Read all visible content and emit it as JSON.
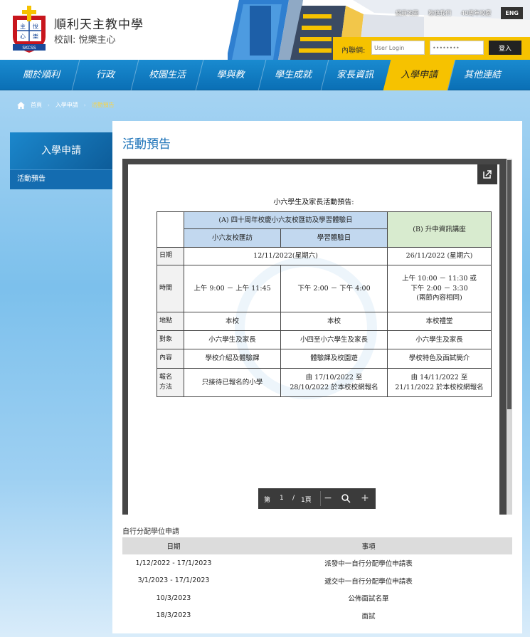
{
  "school": {
    "name": "順利天主教中學",
    "motto": "校訓: 悅樂主心",
    "logo_text": [
      "主",
      "悅",
      "心",
      "樂"
    ],
    "logo_banner": "SKCSS"
  },
  "toplinks": {
    "sitemap": "網頁地圖",
    "contact": "聯絡我們",
    "anniversary": "40周年校慶",
    "eng": "ENG"
  },
  "login": {
    "label": "內聯網:",
    "user_placeholder": "User Login",
    "password_value": "••••••••",
    "button": "登入"
  },
  "nav": [
    {
      "label": "關於順利"
    },
    {
      "label": "行政"
    },
    {
      "label": "校園生活"
    },
    {
      "label": "學與教"
    },
    {
      "label": "學生成就"
    },
    {
      "label": "家長資訊"
    },
    {
      "label": "入學申請"
    },
    {
      "label": "其他連結"
    }
  ],
  "breadcrumb": {
    "home": "首頁",
    "section": "入學申請",
    "current": "活動預告"
  },
  "sidebar": {
    "title": "入學申請",
    "item": "活動預告"
  },
  "page_title": "活動預告",
  "document": {
    "title": "小六學生及家長活動預告:",
    "group_a": "(A) 四十周年校慶小六友校匯訪及學習體驗日",
    "group_b": "(B) 升中資訊講座",
    "sub_a1": "小六友校匯訪",
    "sub_a2": "學習體驗日",
    "rows": {
      "date_label": "日期",
      "date_a": "12/11/2022(星期六)",
      "date_b": "26/11/2022 (星期六)",
      "time_label": "時間",
      "time_a1": "上午 9:00 － 上午 11:45",
      "time_a2": "下午 2:00 － 下午 4:00",
      "time_b_1": "上午 10:00 － 11:30 或",
      "time_b_2": "下午 2:00 － 3:30",
      "time_b_3": "(兩節內容相同)",
      "venue_label": "地點",
      "venue_a1": "本校",
      "venue_a2": "本校",
      "venue_b": "本校禮堂",
      "target_label": "對象",
      "target_a1": "小六學生及家長",
      "target_a2": "小四至小六學生及家長",
      "target_b": "小六學生及家長",
      "content_label": "內容",
      "content_a1": "學校介紹及體驗課",
      "content_a2": "體驗課及校園遊",
      "content_b": "學校特色及面試簡介",
      "reg_label_1": "報名",
      "reg_label_2": "方法",
      "reg_a1": "只接待已報名的小學",
      "reg_a2_1": "由 17/10/2022 至",
      "reg_a2_2": "28/10/2022 於本校校網報名",
      "reg_b_1": "由 14/11/2022 至",
      "reg_b_2": "21/11/2022 於本校校網報名"
    }
  },
  "pager": {
    "prefix": "第",
    "page": "1",
    "sep": "/",
    "total": "1頁",
    "minus": "−",
    "plus": "+"
  },
  "schedule": {
    "title": "自行分配學位申請",
    "headers": [
      "日期",
      "事項"
    ],
    "rows": [
      [
        "1/12/2022 - 17/1/2023",
        "派發中一自行分配學位申請表"
      ],
      [
        "3/1/2023 - 17/1/2023",
        "遞交中一自行分配學位申請表"
      ],
      [
        "10/3/2023",
        "公佈面試名單"
      ],
      [
        "18/3/2023",
        "面試"
      ]
    ]
  },
  "colors": {
    "nav_blue": "#0a6fb5",
    "accent_yellow": "#f6c200",
    "title_blue": "#1b72b8"
  }
}
